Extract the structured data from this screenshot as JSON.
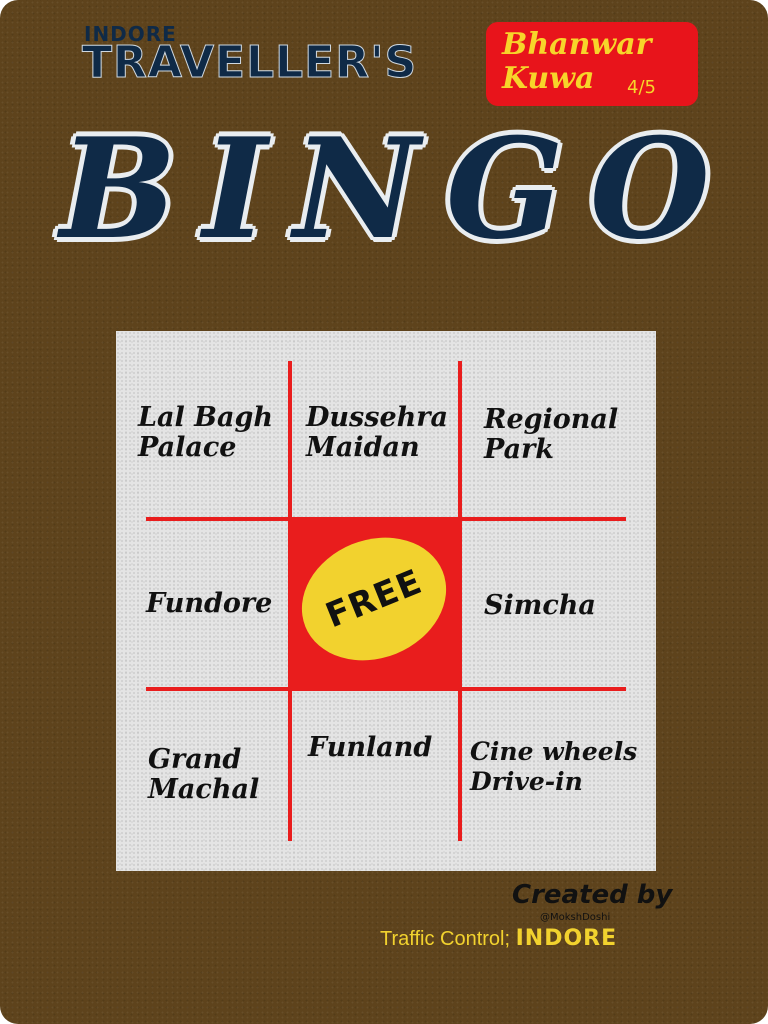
{
  "header": {
    "city": "INDORE",
    "subtitle": "TRAVELLER'S",
    "title_letters": [
      "B",
      "I",
      "N",
      "G",
      "O"
    ]
  },
  "badge": {
    "name_line1": "Bhanwar",
    "name_line2": "Kuwa",
    "rating": "4/5",
    "color": "#e8141b",
    "text_color": "#f7d52a"
  },
  "board": {
    "cells": [
      {
        "id": "lal-bagh-palace",
        "line1": "Lal Bagh",
        "line2": "Palace"
      },
      {
        "id": "dussehra-maidan",
        "line1": "Dussehra",
        "line2": "Maidan"
      },
      {
        "id": "regional-park",
        "line1": "Regional",
        "line2": "Park"
      },
      {
        "id": "fundore",
        "line1": "Fundore",
        "line2": ""
      },
      {
        "id": "free",
        "line1": "FREE",
        "line2": ""
      },
      {
        "id": "simcha",
        "line1": "Simcha",
        "line2": ""
      },
      {
        "id": "grand-machal",
        "line1": "Grand",
        "line2": "Machal"
      },
      {
        "id": "funland",
        "line1": "Funland",
        "line2": ""
      },
      {
        "id": "cine-wheels",
        "line1": "Cine wheels",
        "line2": "Drive-in"
      }
    ],
    "grid_color": "#e91d1d",
    "free_oval_color": "#f2d22e"
  },
  "credit": {
    "label": "Created by",
    "handle": "@MokshDoshi",
    "footer_prefix": "Traffic Control;",
    "footer_city": "INDORE"
  },
  "colors": {
    "background": "#5e431c",
    "title": "#0f2a47"
  }
}
